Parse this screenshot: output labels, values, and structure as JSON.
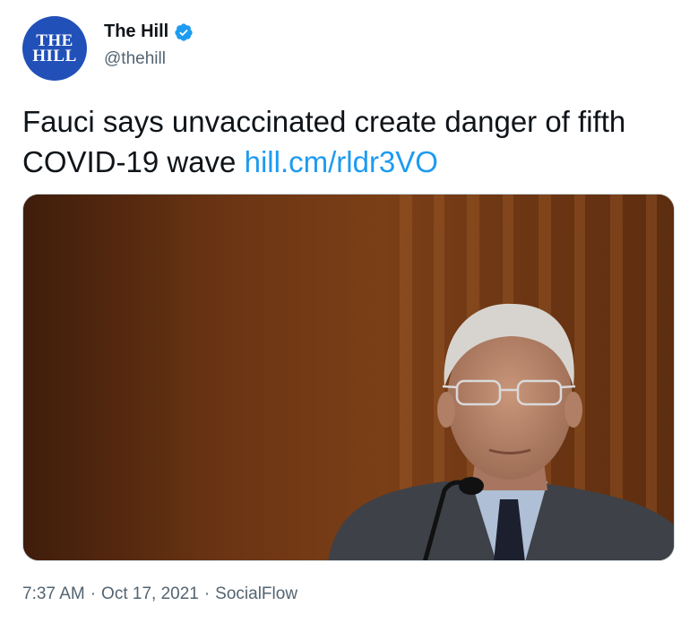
{
  "account": {
    "avatar_line1": "THE",
    "avatar_line2": "HILL",
    "display_name": "The Hill",
    "handle": "@thehill",
    "verified_icon": "verified-badge-icon"
  },
  "tweet": {
    "text": "Fauci says unvaccinated create danger of fifth COVID-19 wave ",
    "link_text": "hill.cm/rldr3VO"
  },
  "media": {
    "alt": "Photo of Anthony Fauci seated in front of a microphone"
  },
  "meta": {
    "time": "7:37 AM",
    "separator1": "·",
    "date": "Oct 17, 2021",
    "separator2": "·",
    "source": "SocialFlow"
  },
  "colors": {
    "link": "#1d9bf0",
    "avatar_bg": "#2150b8",
    "secondary_text": "#536471"
  }
}
